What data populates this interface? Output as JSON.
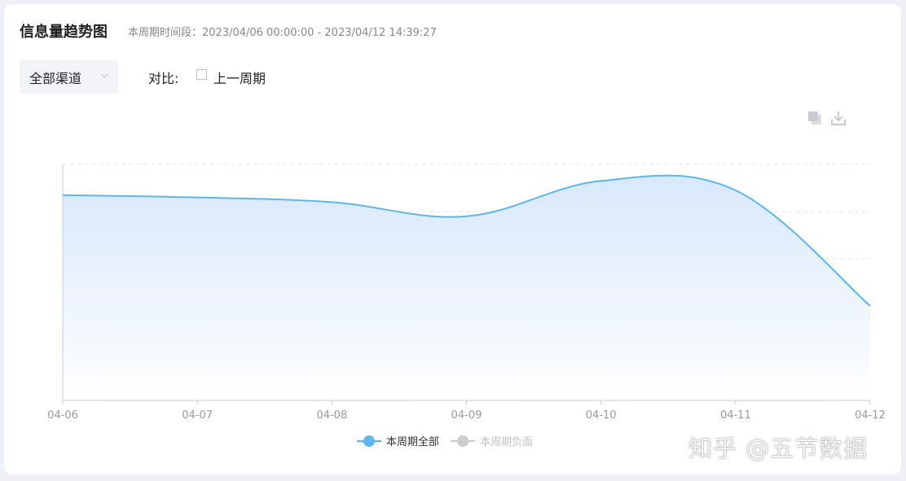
{
  "header": {
    "title": "信息量趋势图",
    "period": "本周期时间段：2023/04/06 00:00:00 - 2023/04/12 14:39:27"
  },
  "filters": {
    "channel_value": "全部渠道",
    "compare_label": "对比:",
    "compare_option": "上一周期",
    "compare_checked": false
  },
  "toolbar": {
    "copy_icon": "copy-icon",
    "download_icon": "download-icon"
  },
  "colors": {
    "line": "#5db6ee",
    "area_top": "#d8e8fc",
    "area_bottom": "#ffffff",
    "grid": "#dfe3ea",
    "axis": "#c8ccd4",
    "tick_text": "#999999",
    "legend_inactive": "#cccccc"
  },
  "chart_data": {
    "type": "area",
    "categories": [
      "04-06",
      "04-07",
      "04-08",
      "04-09",
      "04-10",
      "04-11",
      "04-12"
    ],
    "series": [
      {
        "name": "本周期全部",
        "values": [
          87,
          86,
          84,
          78,
          93,
          89,
          40
        ],
        "active": true
      },
      {
        "name": "本周期负面",
        "values": [],
        "active": false
      }
    ],
    "ylim": [
      0,
      100
    ],
    "y_gridlines": 5,
    "y_tick_labels_visible": false,
    "smooth": true,
    "legend_position": "bottom-center",
    "grid": true
  },
  "watermark": "知乎 @五节数据"
}
